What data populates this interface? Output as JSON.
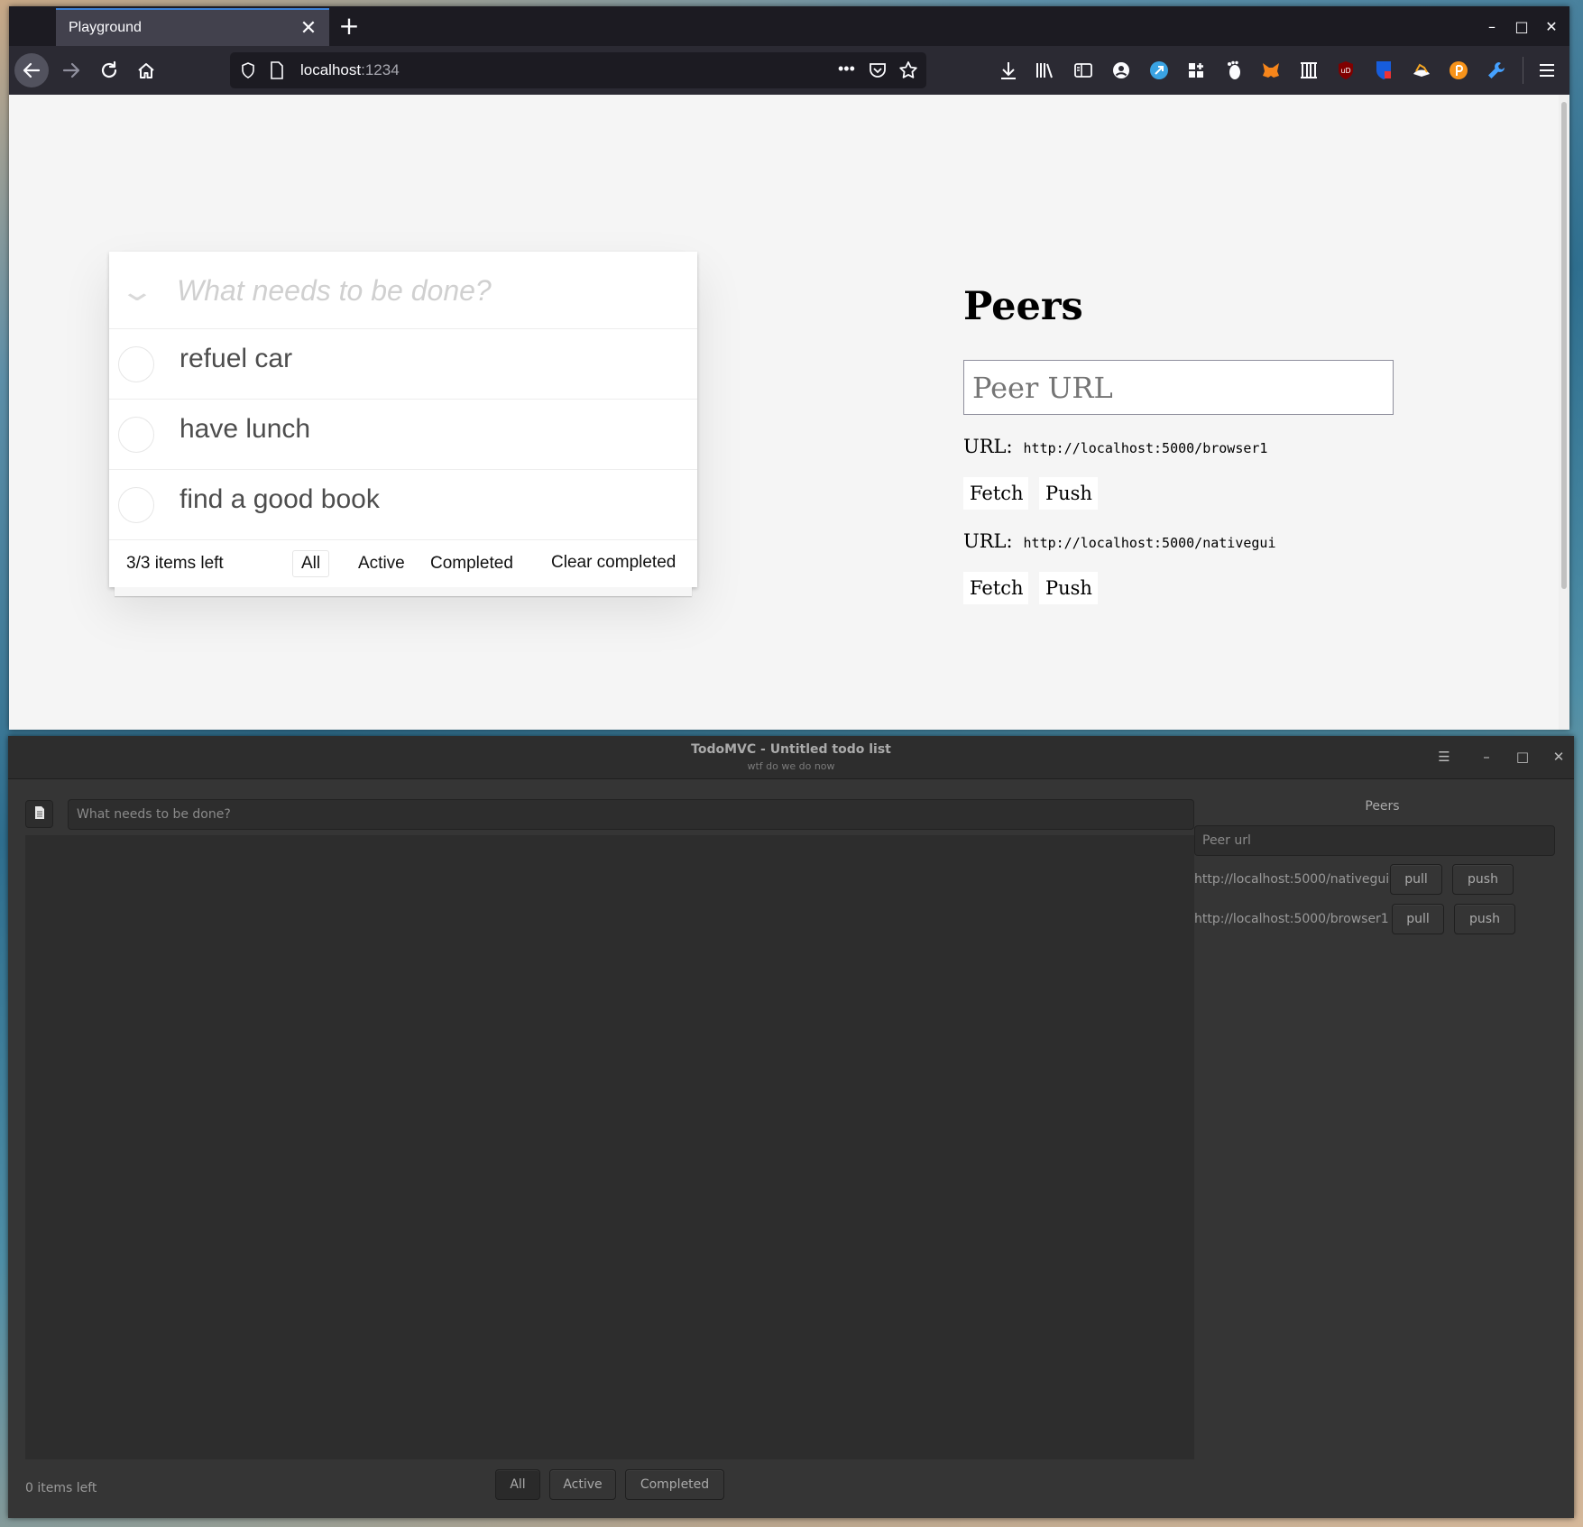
{
  "browser": {
    "tab_title": "Playground",
    "url_host": "localhost",
    "url_port": ":1234"
  },
  "todo": {
    "new_placeholder": "What needs to be done?",
    "items": [
      {
        "label": "refuel car",
        "completed": false
      },
      {
        "label": "have lunch",
        "completed": false
      },
      {
        "label": "find a good book",
        "completed": false
      }
    ],
    "count_text": "3/3 items left",
    "filters": [
      "All",
      "Active",
      "Completed"
    ],
    "selected_filter": "All",
    "clear_label": "Clear completed"
  },
  "peers": {
    "title": "Peers",
    "input_placeholder": "Peer URL",
    "url_label": "URL:",
    "list": [
      {
        "url": "http://localhost:5000/browser1",
        "fetch": "Fetch",
        "push": "Push"
      },
      {
        "url": "http://localhost:5000/nativegui",
        "fetch": "Fetch",
        "push": "Push"
      }
    ]
  },
  "gtk": {
    "title": "TodoMVC - Untitled todo list",
    "subtitle": "wtf do we do now",
    "new_placeholder": "What needs to be done?",
    "count_text": "0 items left",
    "filters": [
      "All",
      "Active",
      "Completed"
    ],
    "peers_title": "Peers",
    "peer_placeholder": "Peer url",
    "peers": [
      {
        "url": "http://localhost:5000/nativegui",
        "pull": "pull",
        "push": "push"
      },
      {
        "url": "http://localhost:5000/browser1",
        "pull": "pull",
        "push": "push"
      }
    ]
  },
  "colors": {
    "firefox_tabbar": "#1c1b22",
    "firefox_toolbar": "#2b2a33",
    "firefox_tab_active_line": "#3b7fd4",
    "gtk_dark_bg": "#353535"
  }
}
